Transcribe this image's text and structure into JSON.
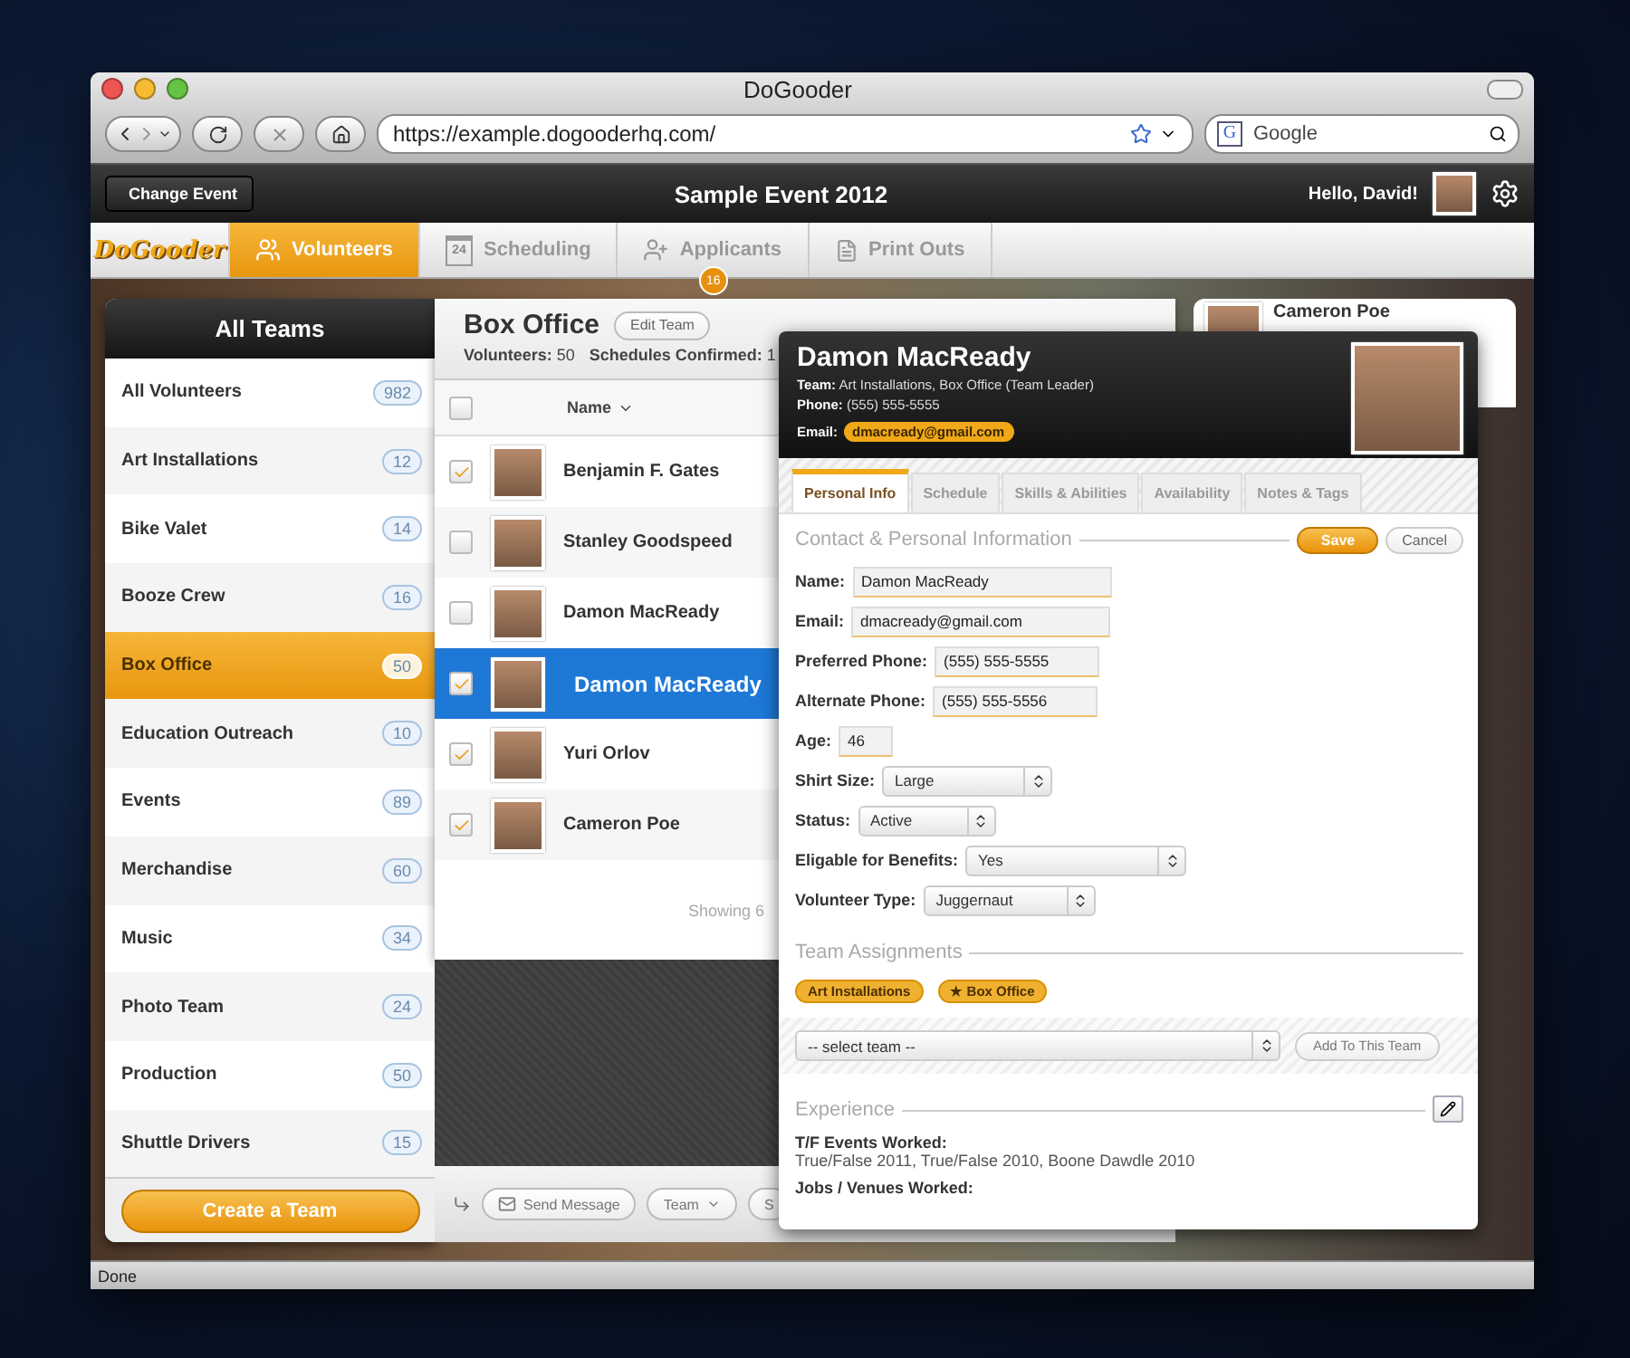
{
  "browser": {
    "title": "DoGooder",
    "url": "https://example.dogooderhq.com/",
    "search_placeholder": "Google",
    "search_engine_mark": "G",
    "status": "Done"
  },
  "header": {
    "back_button": "Change Event",
    "event_title": "Sample Event 2012",
    "greeting": "Hello, David!"
  },
  "nav": {
    "logo": "DoGooder",
    "tabs": [
      {
        "label": "Volunteers",
        "selected": true,
        "kind": "people"
      },
      {
        "label": "Scheduling",
        "selected": false,
        "kind": "calendar",
        "calendar_day": "24"
      },
      {
        "label": "Applicants",
        "selected": false,
        "kind": "add-person",
        "badge": "16"
      },
      {
        "label": "Print Outs",
        "selected": false,
        "kind": "document"
      }
    ]
  },
  "sidebar": {
    "title": "All Teams",
    "teams": [
      {
        "name": "All Volunteers",
        "count": "982",
        "selected": false
      },
      {
        "name": "Art Installations",
        "count": "12",
        "selected": false
      },
      {
        "name": "Bike Valet",
        "count": "14",
        "selected": false
      },
      {
        "name": "Booze Crew",
        "count": "16",
        "selected": false
      },
      {
        "name": "Box Office",
        "count": "50",
        "selected": true
      },
      {
        "name": "Education Outreach",
        "count": "10",
        "selected": false
      },
      {
        "name": "Events",
        "count": "89",
        "selected": false
      },
      {
        "name": "Merchandise",
        "count": "60",
        "selected": false
      },
      {
        "name": "Music",
        "count": "34",
        "selected": false
      },
      {
        "name": "Photo Team",
        "count": "24",
        "selected": false
      },
      {
        "name": "Production",
        "count": "50",
        "selected": false
      },
      {
        "name": "Shuttle Drivers",
        "count": "15",
        "selected": false
      }
    ],
    "create_button": "Create a Team"
  },
  "team_panel": {
    "title": "Box Office",
    "edit_button": "Edit Team",
    "stats": [
      {
        "label": "Volunteers:",
        "value": "50"
      },
      {
        "label": "Schedules Confirmed:",
        "value": "1"
      }
    ],
    "column": "Name",
    "header_checked": false,
    "rows": [
      {
        "name": "Benjamin F. Gates",
        "checked": true,
        "selected": false
      },
      {
        "name": "Stanley Goodspeed",
        "checked": false,
        "selected": false
      },
      {
        "name": "Damon MacReady",
        "checked": false,
        "selected": false
      },
      {
        "name": "Damon MacReady",
        "checked": true,
        "selected": true
      },
      {
        "name": "Yuri Orlov",
        "checked": true,
        "selected": false
      },
      {
        "name": "Cameron Poe",
        "checked": true,
        "selected": false
      }
    ],
    "footer": "Showing 6",
    "actions": [
      {
        "label": "Send Message",
        "kind": "message"
      },
      {
        "label": "Team",
        "kind": "dropdown"
      },
      {
        "label": "S",
        "kind": "plain"
      }
    ]
  },
  "peek": {
    "name": "Cameron Poe"
  },
  "popup": {
    "name": "Damon MacReady",
    "details": [
      {
        "label": "Team:",
        "value": "Art Installations, Box Office (Team Leader)"
      },
      {
        "label": "Phone:",
        "value": "(555) 555-5555"
      }
    ],
    "email_label": "Email:",
    "email": "dmacready@gmail.com",
    "tabs": [
      {
        "label": "Personal Info",
        "selected": true
      },
      {
        "label": "Schedule",
        "selected": false
      },
      {
        "label": "Skills & Abilities",
        "selected": false
      },
      {
        "label": "Availability",
        "selected": false
      },
      {
        "label": "Notes & Tags",
        "selected": false
      }
    ],
    "section": "Contact & Personal Information",
    "save": "Save",
    "cancel": "Cancel",
    "fields": [
      {
        "label": "Name:",
        "value": "Damon MacReady",
        "kind": "input"
      },
      {
        "label": "Email:",
        "value": "dmacready@gmail.com",
        "kind": "input"
      },
      {
        "label": "Preferred Phone:",
        "value": "(555) 555-5555",
        "kind": "input"
      },
      {
        "label": "Alternate Phone:",
        "value": "(555) 555-5556",
        "kind": "input"
      },
      {
        "label": "Age:",
        "value": "46",
        "kind": "short"
      },
      {
        "label": "Shirt Size:",
        "value": "Large",
        "kind": "select"
      },
      {
        "label": "Status:",
        "value": "Active",
        "kind": "select"
      },
      {
        "label": "Eligable for Benefits:",
        "value": "Yes",
        "kind": "select"
      },
      {
        "label": "Volunteer Type:",
        "value": "Juggernaut",
        "kind": "select"
      }
    ],
    "assignments_heading": "Team Assignments",
    "assignments": [
      "Art Installations",
      "★ Box Office"
    ],
    "select_placeholder": "-- select team --",
    "add_button": "Add To This Team",
    "experience_heading": "Experience",
    "experience": [
      {
        "label": "T/F Events Worked:",
        "value": "True/False 2011, True/False 2010, Boone Dawdle 2010"
      },
      {
        "label": "Jobs / Venues Worked:"
      }
    ]
  }
}
